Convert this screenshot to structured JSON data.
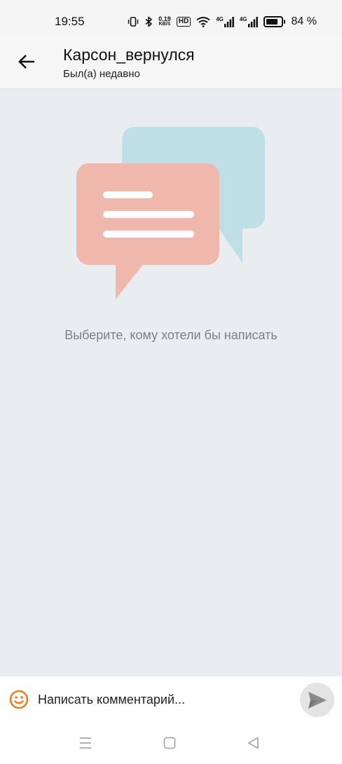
{
  "status_bar": {
    "time": "19:55",
    "speed_value": "0.19",
    "speed_unit": "KB/S",
    "hd": "HD",
    "net1": "4G",
    "net2": "4G",
    "battery_percent": "84 %",
    "battery_level": 0.84
  },
  "header": {
    "title": "Карсон_вернулся",
    "subtitle": "Был(а) недавно"
  },
  "main": {
    "empty_text": "Выберите, кому хотели бы написать"
  },
  "composer": {
    "placeholder": "Написать комментарий..."
  },
  "colors": {
    "accent": "#f07d1a",
    "bubble_front": "#f0b8ac",
    "bubble_back": "#bfdfe7",
    "background": "#e9edf0"
  }
}
